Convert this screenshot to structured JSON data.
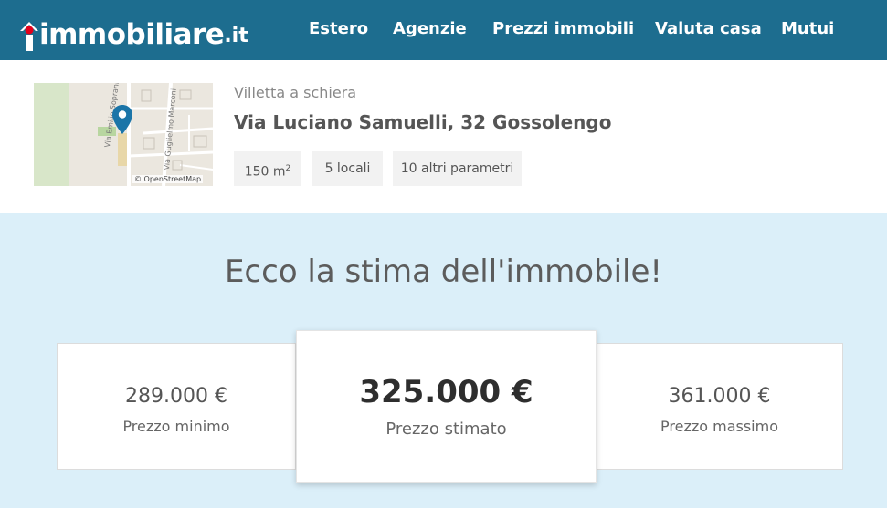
{
  "brand": {
    "name": "immobiliare",
    "ext": ".it",
    "color": "#1d6d8f",
    "dot_color": "#e3001b"
  },
  "nav": [
    {
      "label": "Estero"
    },
    {
      "label": "Agenzie"
    },
    {
      "label": "Prezzi immobili"
    },
    {
      "label": "Valuta casa"
    },
    {
      "label": "Mutui"
    }
  ],
  "property": {
    "type": "Villetta a schiera",
    "address": "Via Luciano Samuelli, 32 Gossolengo",
    "map": {
      "streets": [
        "Via Emilio Soprani",
        "Via Guglielmo Marconi"
      ],
      "attribution": "© OpenStreetMap",
      "icon": "map-pin-icon",
      "pin_color": "#1b75a8"
    },
    "chips": [
      {
        "label": "150 m",
        "sup": "2"
      },
      {
        "label": "5 locali"
      },
      {
        "label": "10 altri parametri"
      }
    ]
  },
  "estimate": {
    "headline": "Ecco la stima dell'immobile!",
    "min": {
      "price": "289.000 €",
      "label": "Prezzo minimo"
    },
    "mid": {
      "price": "325.000 €",
      "label": "Prezzo stimato"
    },
    "max": {
      "price": "361.000 €",
      "label": "Prezzo massimo"
    }
  }
}
